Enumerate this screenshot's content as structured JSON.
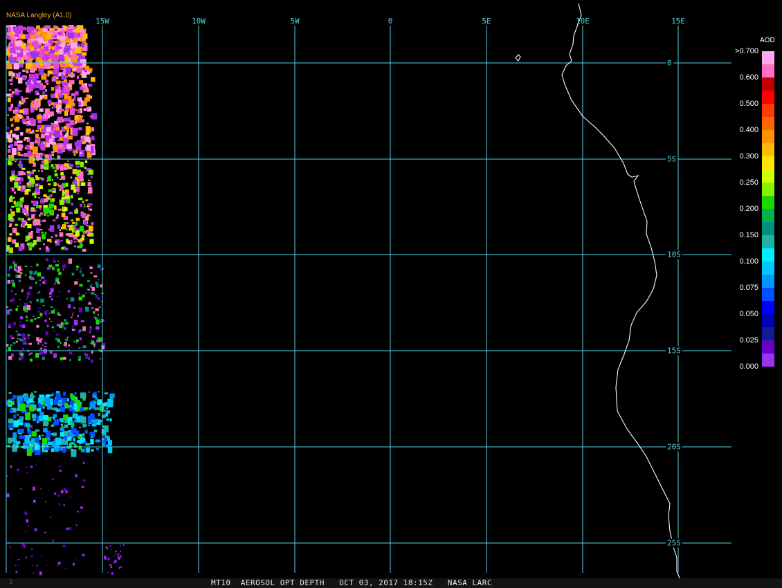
{
  "credit": "NASA Langley (A1.0)",
  "longitude_labels": [
    "15W",
    "10W",
    "5W",
    "0",
    "5E",
    "10E",
    "15E"
  ],
  "latitude_labels": [
    "0",
    "5S",
    "10S",
    "15S",
    "20S",
    "25S"
  ],
  "legend": {
    "title": "AOD",
    "ticks": [
      ">0.700",
      "0.600",
      "0.500",
      "0.400",
      "0.300",
      "0.250",
      "0.200",
      "0.150",
      "0.100",
      "0.075",
      "0.050",
      "0.025",
      "0.000"
    ],
    "colors": [
      "#ffa6ec",
      "#ff6fc2",
      "#c20000",
      "#ff0000",
      "#ff3a00",
      "#ff6400",
      "#ff9300",
      "#ffbc00",
      "#ffe600",
      "#cfff00",
      "#84f500",
      "#1ed700",
      "#00b44e",
      "#008f78",
      "#20b2aa",
      "#00f0ff",
      "#00c8ff",
      "#0096ff",
      "#0050ff",
      "#0000ff",
      "#0000b4",
      "#101c96",
      "#6a00c8",
      "#9b32f0"
    ]
  },
  "footer": {
    "index": "2",
    "text": "MT10  AEROSOL OPT DEPTH   OCT 03, 2017 18:15Z   NASA LARC"
  },
  "colors": {
    "grid": "#4fd6e0",
    "coastline": "#ffffff",
    "background": "#000000"
  }
}
